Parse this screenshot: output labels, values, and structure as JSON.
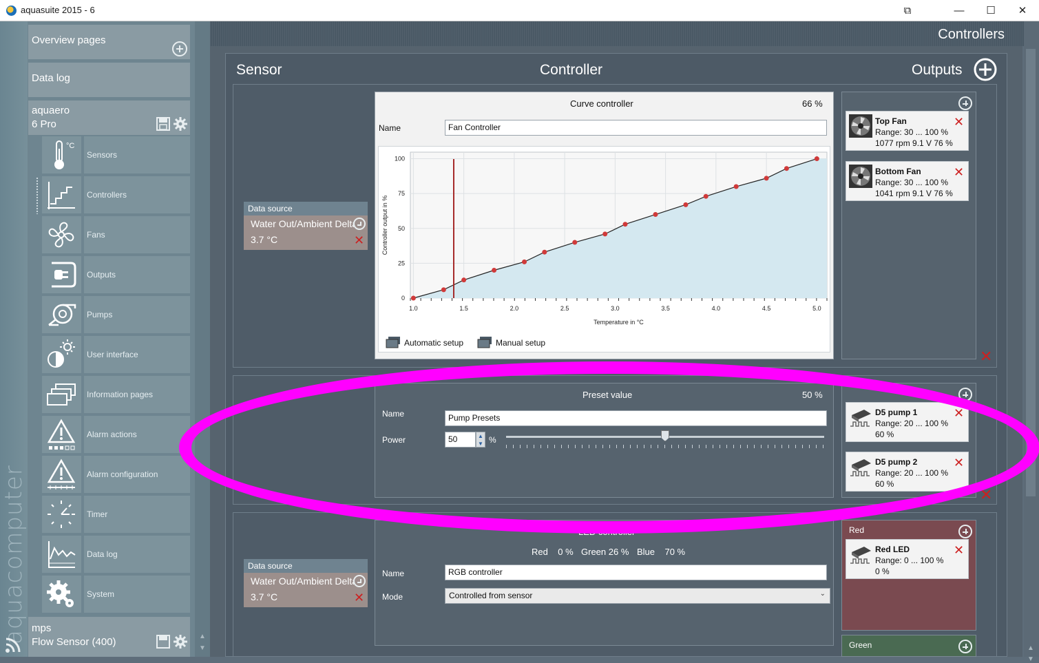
{
  "window": {
    "title": "aquasuite 2015 - 6",
    "buttons": [
      "⧉",
      "—",
      "☐",
      "✕"
    ]
  },
  "sidebar": {
    "brand": "aquacomputer",
    "overview_label": "Overview pages",
    "datalog_label": "Data log",
    "device1": {
      "line1": "aquaero",
      "line2": "6 Pro"
    },
    "items": [
      {
        "label": "Sensors",
        "icon": "thermometer-icon"
      },
      {
        "label": "Controllers",
        "icon": "controller-icon"
      },
      {
        "label": "Fans",
        "icon": "fan-icon"
      },
      {
        "label": "Outputs",
        "icon": "plug-icon"
      },
      {
        "label": "Pumps",
        "icon": "pump-icon"
      },
      {
        "label": "User interface",
        "icon": "brightness-icon"
      },
      {
        "label": "Information pages",
        "icon": "pages-icon"
      },
      {
        "label": "Alarm actions",
        "icon": "alarm-icon"
      },
      {
        "label": "Alarm configuration",
        "icon": "alarm-config-icon"
      },
      {
        "label": "Timer",
        "icon": "timer-icon"
      },
      {
        "label": "Data log",
        "icon": "chart-icon"
      },
      {
        "label": "System",
        "icon": "gear-icon"
      }
    ],
    "device2": {
      "line1": "mps",
      "line2": "Flow Sensor (400)"
    }
  },
  "header": {
    "title": "Controllers"
  },
  "columns": {
    "sensor": "Sensor",
    "controller": "Controller",
    "outputs": "Outputs"
  },
  "curve": {
    "title": "Curve controller",
    "percent": "66 %",
    "name_label": "Name",
    "name_value": "Fan Controller",
    "auto_setup": "Automatic setup",
    "manual_setup": "Manual setup",
    "datasource": {
      "header": "Data source",
      "sensor": "Water Out/Ambient Delta",
      "value": "3.7 °C"
    },
    "outputs": [
      {
        "name": "Top Fan",
        "range": "Range:  30 ... 100  %",
        "status": "1077 rpm  9.1 V  76 %"
      },
      {
        "name": "Bottom Fan",
        "range": "Range:  30 ... 100  %",
        "status": "1041 rpm  9.1 V  76 %"
      }
    ]
  },
  "chart_data": {
    "type": "area",
    "xlabel": "Temperature in °C",
    "ylabel": "Controller output in %",
    "xlim": [
      0.97,
      5.1
    ],
    "ylim": [
      0,
      100
    ],
    "xticks": [
      "1.0",
      "1.5",
      "2.0",
      "2.5",
      "3.0",
      "3.5",
      "4.0",
      "4.5",
      "5.0"
    ],
    "yticks": [
      "0",
      "25",
      "50",
      "75",
      "100"
    ],
    "marker_x": 1.4,
    "x": [
      1.0,
      1.3,
      1.5,
      1.8,
      2.1,
      2.3,
      2.6,
      2.9,
      3.1,
      3.4,
      3.7,
      3.9,
      4.2,
      4.5,
      4.7,
      5.0
    ],
    "y": [
      0,
      6,
      13,
      20,
      26,
      33,
      40,
      46,
      53,
      60,
      67,
      73,
      80,
      86,
      93,
      100
    ]
  },
  "preset": {
    "title": "Preset value",
    "percent": "50 %",
    "name_label": "Name",
    "name_value": "Pump Presets",
    "power_label": "Power",
    "power_value": "50",
    "power_unit": "%",
    "slider_level": 0.5,
    "outputs": [
      {
        "name": "D5 pump 1",
        "range": "Range:  20 ... 100  %",
        "status": "60 %"
      },
      {
        "name": "D5 pump 2",
        "range": "Range:  20 ... 100  %",
        "status": "60 %"
      }
    ]
  },
  "led": {
    "title": "LED controller",
    "rgb_line": {
      "red": "Red    0 %",
      "green": "Green 26 %",
      "blue": "Blue    70 %"
    },
    "name_label": "Name",
    "name_value": "RGB controller",
    "mode_label": "Mode",
    "mode_value": "Controlled from sensor",
    "datasource": {
      "header": "Data source",
      "sensor": "Water Out/Ambient Delta",
      "value": "3.7 °C"
    },
    "red_group": "Red",
    "green_group": "Green",
    "outputs": [
      {
        "name": "Red LED",
        "range": "Range:  0 ... 100  %",
        "status": "0 %"
      }
    ],
    "colors": {
      "red_panel": "#7a4a50",
      "green_panel": "#4a6a52"
    }
  }
}
